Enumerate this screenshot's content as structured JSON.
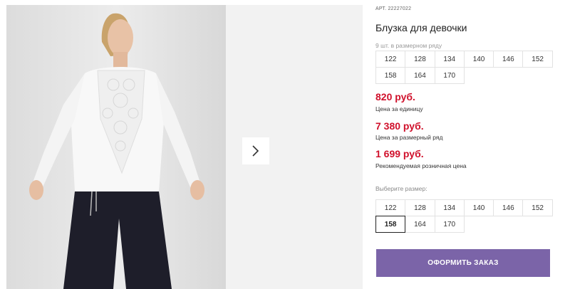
{
  "product": {
    "sku_label": "АРТ.",
    "sku_value": "22227022",
    "title": "Блузка для девочки",
    "image_alt": "girl in white blouse and black wide trousers"
  },
  "gallery": {
    "next_icon": "chevron-right-icon"
  },
  "series": {
    "caption": "9 шт. в размерном ряду",
    "sizes": [
      "122",
      "128",
      "134",
      "140",
      "146",
      "152",
      "158",
      "164",
      "170"
    ]
  },
  "prices": [
    {
      "value": "820 руб.",
      "caption": "Цена за единицу"
    },
    {
      "value": "7 380 руб.",
      "caption": "Цена за размерный ряд"
    },
    {
      "value": "1 699 руб.",
      "caption": "Рекомендуемая розничная цена"
    }
  ],
  "size_select": {
    "label": "Выберите размер:",
    "sizes": [
      "122",
      "128",
      "134",
      "140",
      "146",
      "152",
      "158",
      "164",
      "170"
    ],
    "selected": "158"
  },
  "order_button": {
    "label": "ОФОРМИТЬ ЗАКАЗ"
  },
  "colors": {
    "price": "#d0102b",
    "accent_button": "#7b64a8"
  }
}
